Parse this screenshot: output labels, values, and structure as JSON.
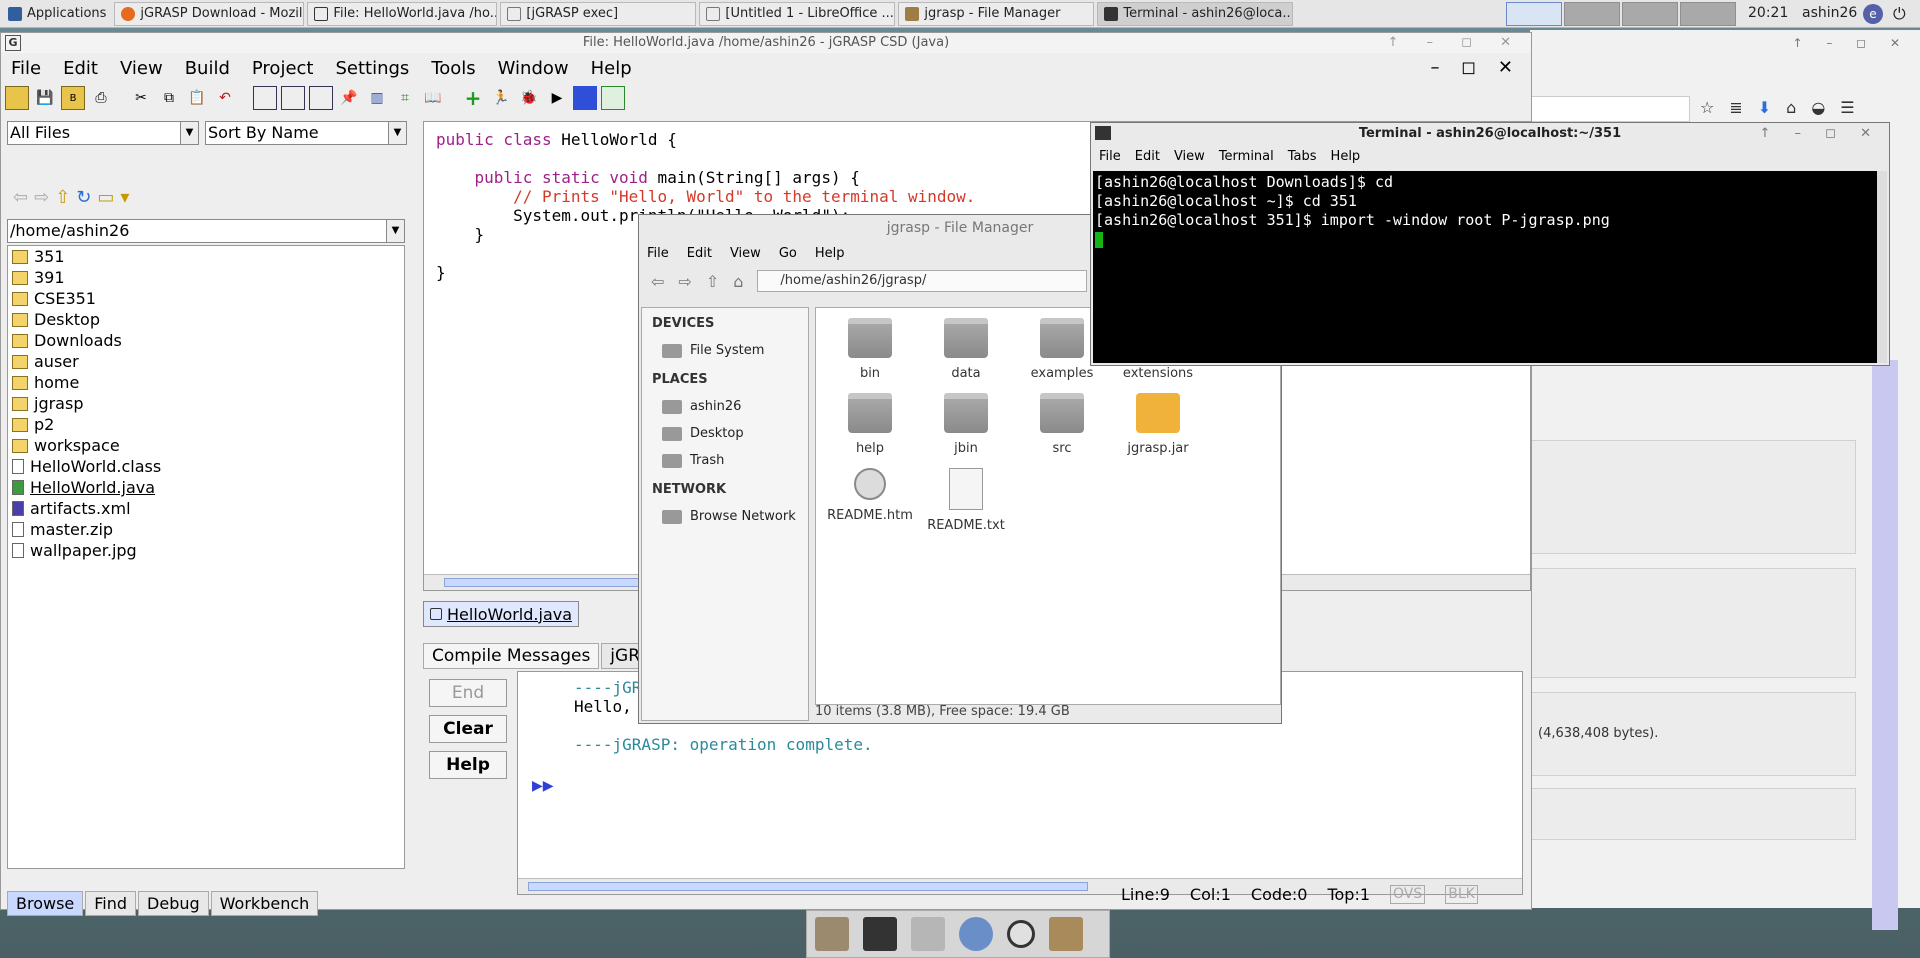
{
  "taskbar": {
    "applications_label": "Applications",
    "tasks": [
      {
        "label": "jGRASP Download - Mozil...",
        "active": false
      },
      {
        "label": "File: HelloWorld.java  /ho...",
        "active": false
      },
      {
        "label": "[jGRASP exec]",
        "active": false
      },
      {
        "label": "[Untitled 1 - LibreOffice ...",
        "active": false
      },
      {
        "label": "jgrasp - File Manager",
        "active": false
      },
      {
        "label": "Terminal - ashin26@loca...",
        "active": true
      }
    ],
    "clock": "20:21",
    "user": "ashin26"
  },
  "firefox": {
    "bytes_text": "(4,638,408 bytes)."
  },
  "jgrasp": {
    "title": "File: HelloWorld.java  /home/ashin26 - jGRASP CSD (Java)",
    "menus": [
      "File",
      "Edit",
      "View",
      "Build",
      "Project",
      "Settings",
      "Tools",
      "Window",
      "Help"
    ],
    "browse": {
      "filter": "All Files",
      "sort": "Sort By Name",
      "path": "/home/ashin26",
      "items": [
        {
          "name": "351",
          "type": "folder"
        },
        {
          "name": "391",
          "type": "folder"
        },
        {
          "name": "CSE351",
          "type": "folder"
        },
        {
          "name": "Desktop",
          "type": "folder"
        },
        {
          "name": "Downloads",
          "type": "folder"
        },
        {
          "name": "auser",
          "type": "folder"
        },
        {
          "name": "home",
          "type": "folder"
        },
        {
          "name": "jgrasp",
          "type": "folder"
        },
        {
          "name": "p2",
          "type": "folder"
        },
        {
          "name": "workspace",
          "type": "folder"
        },
        {
          "name": "HelloWorld.class",
          "type": "file"
        },
        {
          "name": "HelloWorld.java",
          "type": "java"
        },
        {
          "name": "artifacts.xml",
          "type": "xml"
        },
        {
          "name": "master.zip",
          "type": "file"
        },
        {
          "name": "wallpaper.jpg",
          "type": "file"
        }
      ],
      "tabs": [
        "Browse",
        "Find",
        "Debug",
        "Workbench"
      ]
    },
    "editor": {
      "line1_kw": "public class",
      "line1_rest": " HelloWorld {",
      "line2_kw": "public static void",
      "line2_rest": " main(String[] args) {",
      "line3_comment": "// Prints \"Hello, World\" to the terminal window.",
      "line4": "System.out.println(\"Hello, World\");",
      "line5": "}",
      "line6": "}",
      "file_tab": "HelloWorld.java"
    },
    "messages": {
      "tabs": [
        "Compile Messages",
        "jGRASP Messages"
      ],
      "end_label": "End",
      "clear_label": "Clear",
      "help_label": "Help",
      "line1": "----jGRASP exec: java HelloWorld",
      "line2": "Hello, World",
      "line3": "----jGRASP: operation complete."
    },
    "status": {
      "line": "Line:9",
      "col": "Col:1",
      "code": "Code:0",
      "top": "Top:1",
      "ovs": "OVS",
      "blk": "BLK"
    }
  },
  "filemanager": {
    "title": "jgrasp - File Manager",
    "menus": [
      "File",
      "Edit",
      "View",
      "Go",
      "Help"
    ],
    "path": "/home/ashin26/jgrasp/",
    "sections": {
      "devices": "DEVICES",
      "places": "PLACES",
      "network": "NETWORK"
    },
    "devices": [
      "File System"
    ],
    "places": [
      "ashin26",
      "Desktop",
      "Trash"
    ],
    "network": [
      "Browse Network"
    ],
    "items": [
      {
        "name": "bin",
        "type": "folder"
      },
      {
        "name": "data",
        "type": "folder"
      },
      {
        "name": "examples",
        "type": "folder"
      },
      {
        "name": "extensions",
        "type": "folder"
      },
      {
        "name": "help",
        "type": "folder"
      },
      {
        "name": "jbin",
        "type": "folder"
      },
      {
        "name": "src",
        "type": "folder"
      },
      {
        "name": "jgrasp.jar",
        "type": "jar"
      },
      {
        "name": "README.htm",
        "type": "htm"
      },
      {
        "name": "README.txt",
        "type": "txt"
      }
    ],
    "status": "10 items (3.8 MB), Free space: 19.4 GB"
  },
  "terminal": {
    "title": "Terminal - ashin26@localhost:~/351",
    "menus": [
      "File",
      "Edit",
      "View",
      "Terminal",
      "Tabs",
      "Help"
    ],
    "lines": [
      "[ashin26@localhost Downloads]$ cd",
      "[ashin26@localhost ~]$ cd 351",
      "[ashin26@localhost 351]$ import -window root P-jgrasp.png"
    ]
  }
}
